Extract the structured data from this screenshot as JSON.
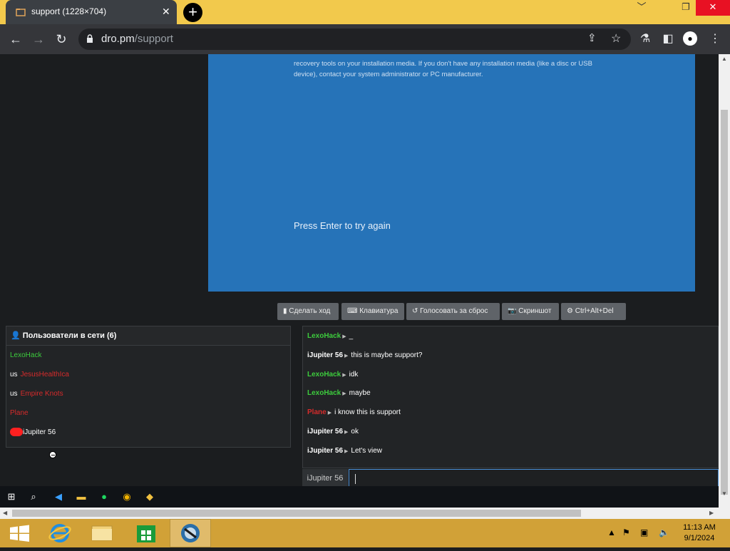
{
  "browser": {
    "tab_title": "support (1228×704)",
    "tab_close": "✕",
    "new_tab": "+",
    "url_host": "dro.pm",
    "url_path": "/support",
    "win_min": "﹀",
    "win_restore": "❐",
    "win_close": "✕"
  },
  "remote_screen": {
    "message": "recovery tools on your installation media. If you don't have any installation media (like a disc or USB device), contact your system administrator or PC manufacturer.",
    "press_enter": "Press Enter to try again"
  },
  "controls": [
    {
      "icon": "▮",
      "label": "Сделать ход"
    },
    {
      "icon": "⌨",
      "label": "Клавиатура"
    },
    {
      "icon": "↺",
      "label": "Голосовать за сброс"
    },
    {
      "icon": "📷",
      "label": "Скриншот"
    },
    {
      "icon": "⚙",
      "label": "Ctrl+Alt+Del"
    }
  ],
  "users_panel": {
    "title": "Пользователи в сети (6)",
    "users": [
      {
        "prefix": "",
        "name": "LexoHack",
        "color": "#3dcc3d"
      },
      {
        "prefix": "us",
        "name": "JesusHealthIca",
        "color": "#d62b2b"
      },
      {
        "prefix": "us",
        "name": "Empire Knots",
        "color": "#d62b2b"
      },
      {
        "prefix": "",
        "name": "Plane",
        "color": "#d62b2b"
      },
      {
        "prefix": "",
        "name": "iJupiter 56",
        "color": "#ffffff"
      }
    ]
  },
  "chat": {
    "messages": [
      {
        "name": "LexoHack",
        "color": "#3dcc3d",
        "text": "_"
      },
      {
        "name": "iJupiter 56",
        "color": "#ffffff",
        "text": "this is maybe support?"
      },
      {
        "name": "LexoHack",
        "color": "#3dcc3d",
        "text": "idk"
      },
      {
        "name": "LexoHack",
        "color": "#3dcc3d",
        "text": "maybe"
      },
      {
        "name": "Plane",
        "color": "#d62b2b",
        "text": "i know this is support"
      },
      {
        "name": "iJupiter 56",
        "color": "#ffffff",
        "text": "ok"
      },
      {
        "name": "iJupiter 56",
        "color": "#ffffff",
        "text": "Let's view"
      }
    ],
    "input_user": "iJupiter 56",
    "input_value": ""
  },
  "system": {
    "time": "11:13 AM",
    "date": "9/1/2024"
  }
}
